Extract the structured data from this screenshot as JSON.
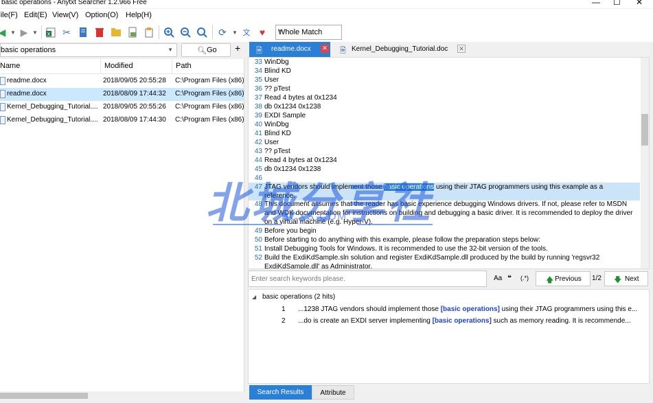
{
  "window": {
    "title": "basic operations - Anytxt Searcher 1.2.966 Free"
  },
  "menu": [
    {
      "label": "File(F)"
    },
    {
      "label": "Edit(E)"
    },
    {
      "label": "View(V)"
    },
    {
      "label": "Option(O)"
    },
    {
      "label": "Help(H)"
    }
  ],
  "toolbar": {
    "match_mode": "Whole Match"
  },
  "search": {
    "query": "basic operations",
    "go_label": "Go",
    "add_label": "+"
  },
  "filelist": {
    "headers": {
      "name": "Name",
      "modified": "Modified",
      "path": "Path"
    },
    "rows": [
      {
        "name": "readme.docx",
        "modified": "2018/09/05 20:55:28",
        "path": "C:\\Program Files (x86)\\"
      },
      {
        "name": "readme.docx",
        "modified": "2018/08/09 17:44:32",
        "path": "C:\\Program Files (x86)\\"
      },
      {
        "name": "Kernel_Debugging_Tutorial....",
        "modified": "2018/09/05 20:55:26",
        "path": "C:\\Program Files (x86)\\"
      },
      {
        "name": "Kernel_Debugging_Tutorial....",
        "modified": "2018/08/09 17:44:30",
        "path": "C:\\Program Files (x86)\\"
      }
    ]
  },
  "tabs": [
    {
      "label": "readme.docx",
      "icon": "docx-icon"
    },
    {
      "label": "Kernel_Debugging_Tutorial.doc",
      "icon": "doc-icon"
    }
  ],
  "preview": {
    "lines": [
      {
        "n": "33",
        "t": "WinDbg"
      },
      {
        "n": "34",
        "t": "Blind KD"
      },
      {
        "n": "35",
        "t": "User"
      },
      {
        "n": "36",
        "t": "?? pTest"
      },
      {
        "n": "37",
        "t": "Read 4 bytes at 0x1234"
      },
      {
        "n": "38",
        "t": "db 0x1234 0x1238"
      },
      {
        "n": "39",
        "t": "EXDI Sample"
      },
      {
        "n": "40",
        "t": "WinDbg"
      },
      {
        "n": "41",
        "t": "Blind KD"
      },
      {
        "n": "42",
        "t": "User"
      },
      {
        "n": "43",
        "t": "?? pTest"
      },
      {
        "n": "44",
        "t": "Read 4 bytes at 0x1234"
      },
      {
        "n": "45",
        "t": "db 0x1234 0x1238"
      },
      {
        "n": "46",
        "t": ""
      }
    ],
    "hl_line": {
      "n": "47",
      "pre": "JTAG vendors should implement those ",
      "kw": "basic operations",
      "post": " using their JTAG programmers using this example as a",
      "cont": "reference."
    },
    "tail_lines": [
      {
        "n": "48",
        "t": "This document assumes that the reader has basic experience debugging Windows drivers. If not, please refer to MSDN",
        "t2": "and WDK documentation for instructions on building and debugging a basic driver. It is recommended to deploy the driver",
        "t3": "on a virtual machine (e.g. Hyper-V)."
      },
      {
        "n": "49",
        "t": "Before you begin"
      },
      {
        "n": "50",
        "t": "Before starting to do anything with this example, please follow the preparation steps below:"
      },
      {
        "n": "51",
        "t": "Install Debugging Tools for Windows. It is recommended to use the 32-bit version of the tools."
      },
      {
        "n": "52",
        "t": "Build the ExdiKdSample.sln solution and register ExdiKdSample.dll produced by the build by running 'regsvr32",
        "t2": "ExdiKdSample.dll' as Administrator."
      }
    ]
  },
  "findbar": {
    "placeholder": "Enter search keywords please.",
    "opt_case": "Aa",
    "opt_word": "❝",
    "opt_regex": "(.*)",
    "prev_label": "Previous",
    "next_label": "Next",
    "page": "1/2"
  },
  "results": {
    "group": "basic operations (2 hits)",
    "hits": [
      {
        "num": "1",
        "pre": "...1238 JTAG vendors should implement those ",
        "kw": "[basic operations]",
        "post": " using their JTAG programmers using this e..."
      },
      {
        "num": "2",
        "pre": "...do is create an EXDI server implementing ",
        "kw": "[basic operations]",
        "post": " such as memory reading. It is recommende..."
      }
    ]
  },
  "bottom_tabs": [
    {
      "label": "Search Results"
    },
    {
      "label": "Attribute"
    }
  ],
  "watermark": {
    "big": "北城分享社",
    "small": "BCXS.COM"
  },
  "colors": {
    "accent": "#2c7fd6",
    "keyword": "#1f3fd6",
    "selection": "#cce8ff"
  }
}
